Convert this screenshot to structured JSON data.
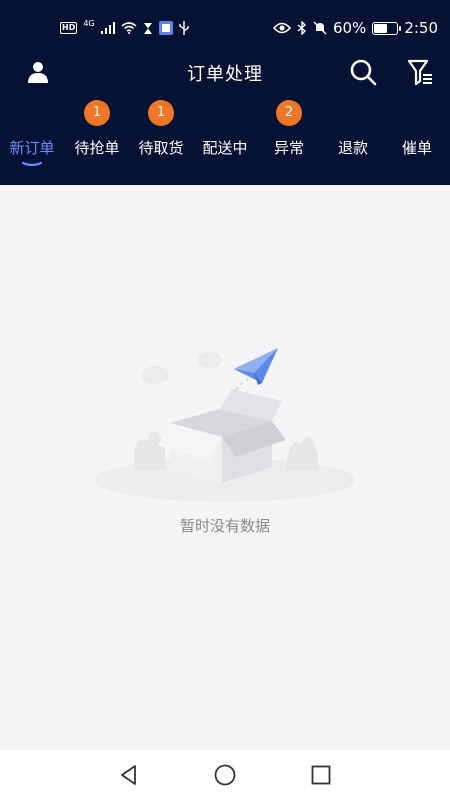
{
  "status_bar": {
    "left_badges": [
      "HD",
      "4G"
    ],
    "battery_percent": "60%",
    "battery_level": 0.6,
    "time": "2:50"
  },
  "header": {
    "title": "订单处理",
    "left_icon": "user-icon",
    "right_icons": [
      "search-icon",
      "filter-icon"
    ]
  },
  "tabs": [
    {
      "label": "新订单",
      "badge": null,
      "active": true
    },
    {
      "label": "待抢单",
      "badge": "1",
      "active": false
    },
    {
      "label": "待取货",
      "badge": "1",
      "active": false
    },
    {
      "label": "配送中",
      "badge": null,
      "active": false
    },
    {
      "label": "异常",
      "badge": "2",
      "active": false
    },
    {
      "label": "退款",
      "badge": null,
      "active": false
    },
    {
      "label": "催单",
      "badge": null,
      "active": false
    }
  ],
  "empty_state": {
    "message": "暂时没有数据",
    "icon": "empty-box-paper-plane-illustration"
  },
  "nav_bar": {
    "buttons": [
      "back-icon",
      "home-icon",
      "recents-icon"
    ]
  },
  "colors": {
    "header_bg": "#061233",
    "active_tab": "#6c8cff",
    "badge": "#f0772a",
    "page_bg": "#f5f5f7"
  }
}
